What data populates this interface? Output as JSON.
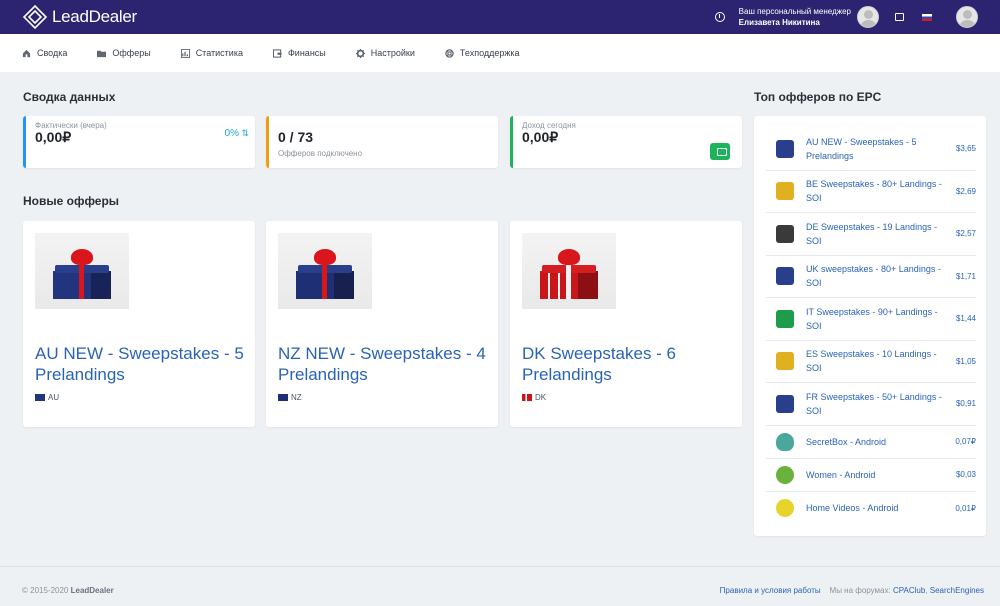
{
  "header": {
    "logo": "LeadDealer",
    "manager_label": "Ваш персональный менеджер",
    "manager_name": "Елизавета Никитина"
  },
  "nav": [
    {
      "label": "Сводка",
      "icon": "home-icon"
    },
    {
      "label": "Офферы",
      "icon": "folder-icon"
    },
    {
      "label": "Статистика",
      "icon": "chart-icon"
    },
    {
      "label": "Финансы",
      "icon": "wallet-icon"
    },
    {
      "label": "Настройки",
      "icon": "gear-icon"
    },
    {
      "label": "Техподдержка",
      "icon": "lifebuoy-icon"
    }
  ],
  "summary": {
    "title": "Сводка данных",
    "cards": [
      {
        "label": "Фактически (вчера)",
        "value": "0,00₽",
        "pct": "0%",
        "accent": "#2196f3"
      },
      {
        "label": "Офферов подключено",
        "value": "0 / 73",
        "accent": "#f39c12"
      },
      {
        "label": "Доход сегодня",
        "value": "0,00₽",
        "accent": "#1cb35b"
      }
    ]
  },
  "new_offers": {
    "title": "Новые офферы",
    "items": [
      {
        "title": "AU NEW - Sweepstakes - 5 Prelandings",
        "geo": "AU",
        "flag": "au"
      },
      {
        "title": "NZ NEW - Sweepstakes - 4 Prelandings",
        "geo": "NZ",
        "flag": "nz"
      },
      {
        "title": "DK Sweepstakes - 6 Prelandings",
        "geo": "DK",
        "flag": "dk"
      }
    ]
  },
  "top_offers": {
    "title": "Топ офферов по EPC",
    "items": [
      {
        "name": "AU NEW - Sweepstakes - 5 Prelandings",
        "epc": "$3,65",
        "color": "#2a3f8c"
      },
      {
        "name": "BE Sweepstakes - 80+ Landings - SOI",
        "epc": "$2,69",
        "color": "#e0b020"
      },
      {
        "name": "DE Sweepstakes - 19 Landings - SOI",
        "epc": "$2,57",
        "color": "#3a3a3a"
      },
      {
        "name": "UK sweepstakes - 80+ Landings - SOI",
        "epc": "$1,71",
        "color": "#2a3f8c"
      },
      {
        "name": "IT Sweepstakes - 90+ Landings - SOI",
        "epc": "$1,44",
        "color": "#1e9c4a"
      },
      {
        "name": "ES Sweepstakes - 10 Landings - SOI",
        "epc": "$1,05",
        "color": "#e0b020"
      },
      {
        "name": "FR Sweepstakes - 50+ Landings - SOI",
        "epc": "$0,91",
        "color": "#2a3f8c"
      },
      {
        "name": "SecretBox - Android",
        "epc": "0,07₽",
        "color": "#4aa89a"
      },
      {
        "name": "Women - Android",
        "epc": "$0,03",
        "color": "#6ab23c"
      },
      {
        "name": "Home Videos - Android",
        "epc": "0,01₽",
        "color": "#e8d32c"
      }
    ]
  },
  "footer": {
    "copyright": "© 2015-2020",
    "brand": "LeadDealer",
    "rules": "Правила и условия работы",
    "forums_label": "Мы на форумах:",
    "forum1": "CPAClub",
    "forum2": "SearchEngines"
  }
}
